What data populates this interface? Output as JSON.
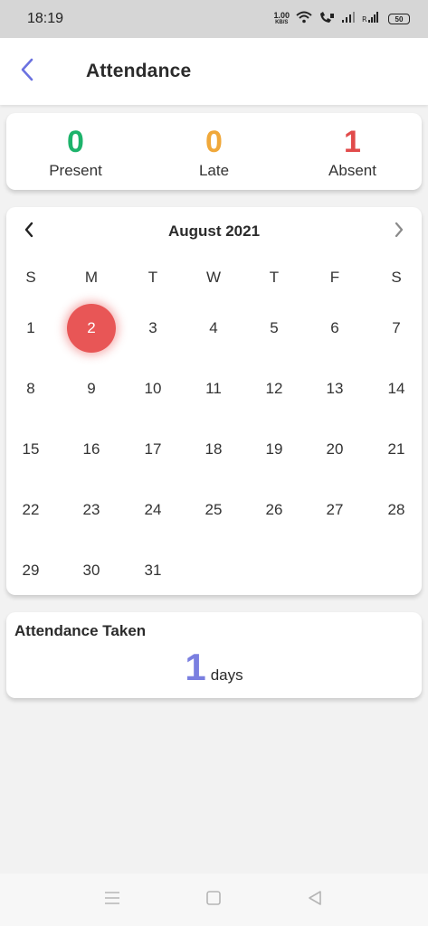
{
  "status_bar": {
    "time": "18:19",
    "net_speed_value": "1.00",
    "net_speed_unit": "KB/S",
    "battery": "50"
  },
  "header": {
    "title": "Attendance",
    "back_icon": "chevron-left-icon"
  },
  "summary": {
    "items": [
      {
        "value": "0",
        "label": "Present",
        "color": "#1db36b"
      },
      {
        "value": "0",
        "label": "Late",
        "color": "#f0a83a"
      },
      {
        "value": "1",
        "label": "Absent",
        "color": "#e14b4b"
      }
    ]
  },
  "calendar": {
    "month_label": "August 2021",
    "weekdays": [
      "S",
      "M",
      "T",
      "W",
      "T",
      "F",
      "S"
    ],
    "weeks": [
      [
        "1",
        "2",
        "3",
        "4",
        "5",
        "6",
        "7"
      ],
      [
        "8",
        "9",
        "10",
        "11",
        "12",
        "13",
        "14"
      ],
      [
        "15",
        "16",
        "17",
        "18",
        "19",
        "20",
        "21"
      ],
      [
        "22",
        "23",
        "24",
        "25",
        "26",
        "27",
        "28"
      ],
      [
        "29",
        "30",
        "31",
        "",
        "",
        "",
        ""
      ]
    ],
    "selected_day": "2",
    "selected_color": "#e85656"
  },
  "attendance_taken": {
    "label": "Attendance Taken",
    "value": "1",
    "unit": "days",
    "value_color": "#7a7fe0"
  },
  "accent_color": "#6b72e0"
}
